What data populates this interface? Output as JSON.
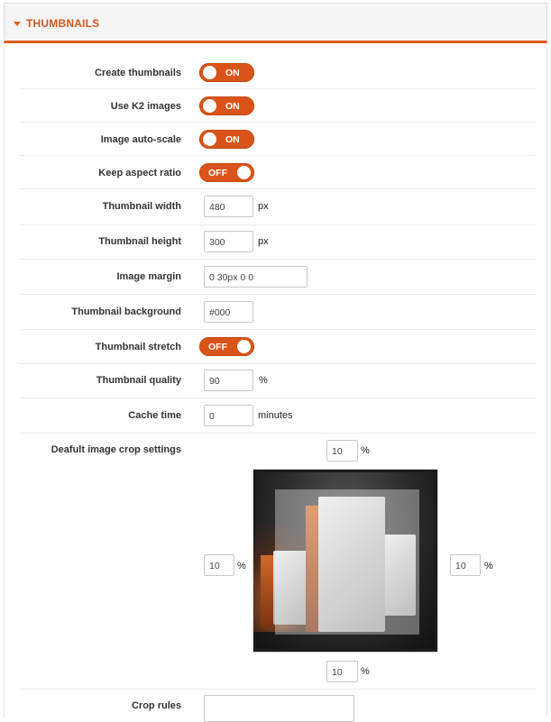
{
  "header": {
    "title": "THUMBNAILS"
  },
  "rows": {
    "create_thumbnails": {
      "label": "Create thumbnails",
      "state": "ON"
    },
    "use_k2": {
      "label": "Use K2 images",
      "state": "ON"
    },
    "auto_scale": {
      "label": "Image auto-scale",
      "state": "ON"
    },
    "keep_aspect": {
      "label": "Keep aspect ratio",
      "state": "OFF"
    },
    "thumb_width": {
      "label": "Thumbnail width",
      "value": "480",
      "unit": "px"
    },
    "thumb_height": {
      "label": "Thumbnail height",
      "value": "300",
      "unit": "px"
    },
    "image_margin": {
      "label": "Image margin",
      "value": "0 30px 0 0"
    },
    "thumb_bg": {
      "label": "Thumbnail background",
      "value": "#000"
    },
    "thumb_stretch": {
      "label": "Thumbnail stretch",
      "state": "OFF"
    },
    "thumb_quality": {
      "label": "Thumbnail quality",
      "value": "90",
      "unit": "%"
    },
    "cache_time": {
      "label": "Cache time",
      "value": "0",
      "unit": "minutes"
    },
    "crop": {
      "label": "Deafult image crop settings",
      "top": "10",
      "left": "10",
      "right": "10",
      "bottom": "10",
      "unit": "%"
    },
    "crop_rules": {
      "label": "Crop rules",
      "value": ""
    }
  },
  "colors": {
    "accent": "#d9541a",
    "header_text": "#d2571d"
  }
}
